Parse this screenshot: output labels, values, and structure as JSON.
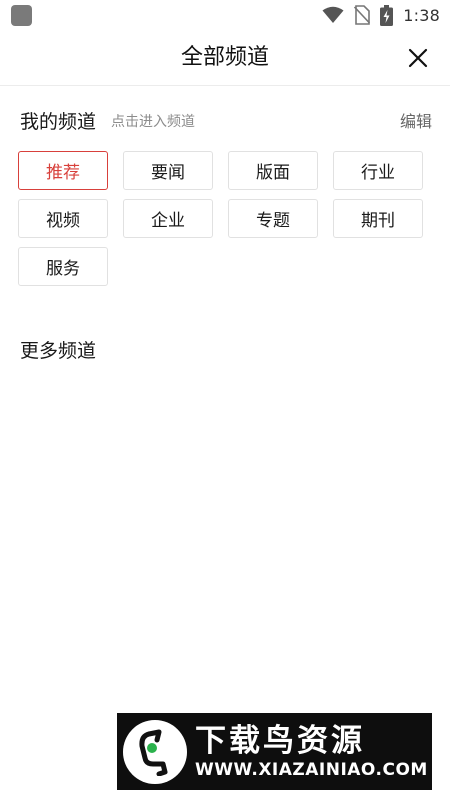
{
  "status_bar": {
    "time": "1:38",
    "icons": [
      "notification-square-icon",
      "wifi-icon",
      "no-sim-icon",
      "battery-charging-icon"
    ]
  },
  "header": {
    "title": "全部频道",
    "close_icon": "close-icon"
  },
  "my_channels": {
    "title": "我的频道",
    "hint": "点击进入频道",
    "edit_label": "编辑",
    "channels": [
      {
        "label": "推荐",
        "active": true
      },
      {
        "label": "要闻"
      },
      {
        "label": "版面"
      },
      {
        "label": "行业"
      },
      {
        "label": "视频"
      },
      {
        "label": "企业"
      },
      {
        "label": "专题"
      },
      {
        "label": "期刊"
      },
      {
        "label": "服务"
      }
    ]
  },
  "more_channels": {
    "title": "更多频道"
  },
  "watermark": {
    "title": "下载鸟资源",
    "url": "WWW.XIAZAINIAO.COM",
    "logo_icon": "bird-logo-icon"
  },
  "colors": {
    "accent": "#d8403b",
    "chip_border": "#e1e1e1"
  }
}
